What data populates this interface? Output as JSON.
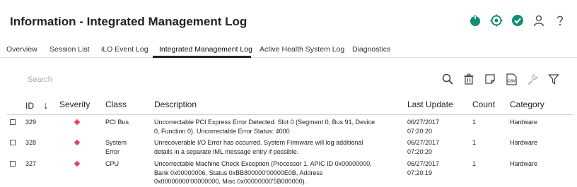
{
  "header": {
    "title": "Information - Integrated Management Log",
    "icons": [
      {
        "name": "power-icon",
        "color": "#148b75"
      },
      {
        "name": "location-icon",
        "color": "#148b75"
      },
      {
        "name": "health-ok-icon",
        "color": "#148b75"
      },
      {
        "name": "user-icon",
        "color": "#555555"
      },
      {
        "name": "help-icon",
        "color": "#555555"
      }
    ]
  },
  "tabs": [
    {
      "label": "Overview"
    },
    {
      "label": "Session List"
    },
    {
      "label": "iLO Event Log"
    },
    {
      "label": "Integrated Management Log",
      "active": true
    },
    {
      "label": "Active Health System Log"
    },
    {
      "label": "Diagnostics"
    }
  ],
  "search": {
    "placeholder": "Search"
  },
  "toolbar": {
    "icons": [
      "search-icon",
      "trash-icon",
      "note-icon",
      "csv-icon",
      "wrench-icon",
      "filter-icon"
    ],
    "csv_label": "CSV"
  },
  "table": {
    "columns": {
      "id": "ID",
      "severity": "Severity",
      "class": "Class",
      "description": "Description",
      "last_update": "Last Update",
      "count": "Count",
      "category": "Category"
    },
    "sort_indicator": "↓",
    "severity_color": "#e8435a",
    "rows": [
      {
        "id": "329",
        "class": [
          "PCI Bus"
        ],
        "description": [
          "Uncorrectable PCI Express Error Detected. Slot 0 (Segment 0, Bus 91, Device",
          "0, Function 0). Uncorrectable Error Status: 4000"
        ],
        "last_update": [
          "06/27/2017",
          "07:20:20"
        ],
        "count": "1",
        "category": "Hardware"
      },
      {
        "id": "328",
        "class": [
          "System",
          "Error"
        ],
        "description": [
          "Unrecoverable I/O Error has occurred. System Firmware will log additional",
          "details in a separate IML message entry if possible."
        ],
        "last_update": [
          "06/27/2017",
          "07:20:20"
        ],
        "count": "1",
        "category": "Hardware"
      },
      {
        "id": "327",
        "class": [
          "CPU"
        ],
        "description": [
          "Uncorrectable Machine Check Exception (Processor 1, APIC ID 0x00000000,",
          "Bank 0x00000006, Status 0xBB800000'00000E0B, Address",
          "0x00000000'00000000, Misc 0x00000000'5B000000)."
        ],
        "last_update": [
          "06/27/2017",
          "07:20:19"
        ],
        "count": "1",
        "category": "Hardware"
      }
    ]
  }
}
